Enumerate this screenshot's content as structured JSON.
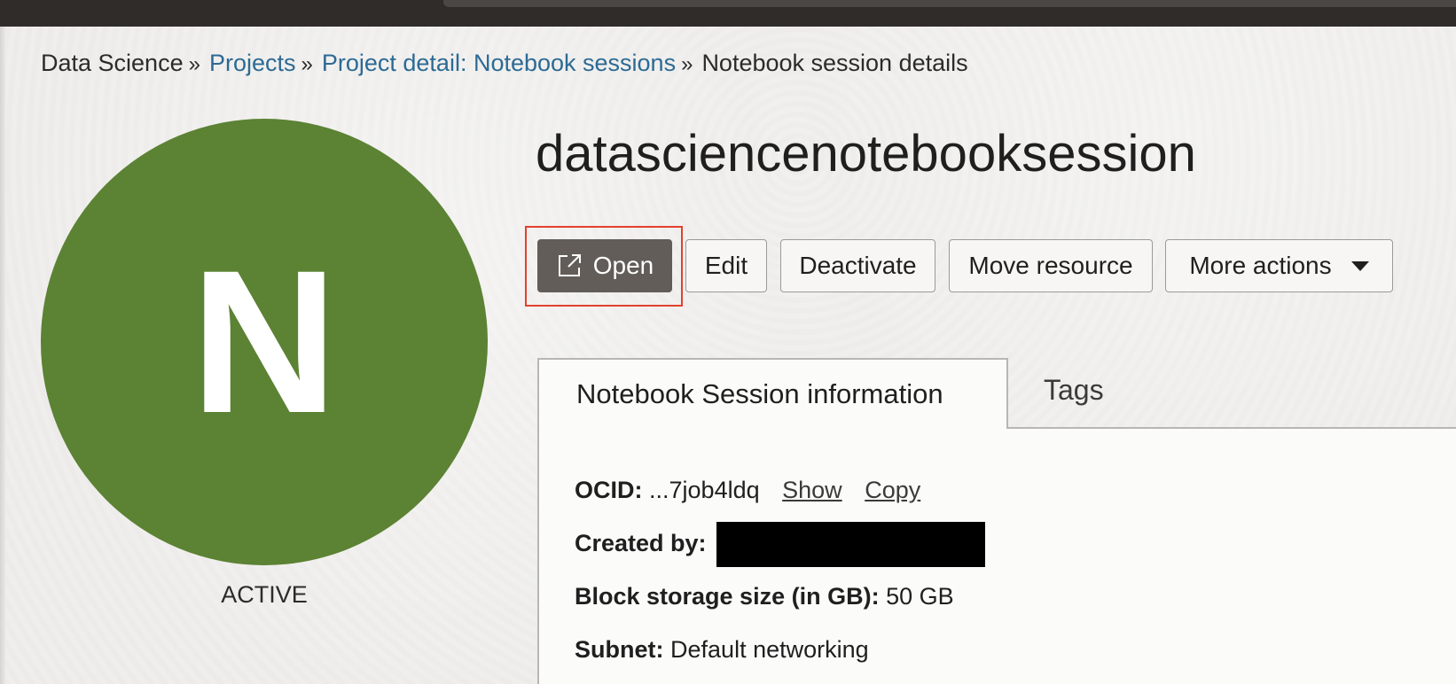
{
  "breadcrumb": {
    "root": "Data Science",
    "projects": "Projects",
    "project_detail": "Project detail: Notebook sessions",
    "current": "Notebook session details",
    "separator": "»"
  },
  "avatar": {
    "letter": "N",
    "color": "#5c8234",
    "status": "ACTIVE"
  },
  "title": "datasciencenotebooksession",
  "actions": {
    "open": "Open",
    "edit": "Edit",
    "deactivate": "Deactivate",
    "move_resource": "Move resource",
    "more_actions": "More actions"
  },
  "tabs": [
    {
      "label": "Notebook Session information",
      "active": true
    },
    {
      "label": "Tags",
      "active": false
    }
  ],
  "info": {
    "ocid_label": "OCID:",
    "ocid_value": "...7job4ldq",
    "show_link": "Show",
    "copy_link": "Copy",
    "created_by_label": "Created by:",
    "storage_label": "Block storage size (in GB):",
    "storage_value": "50 GB",
    "subnet_label": "Subnet:",
    "subnet_value": "Default networking"
  },
  "colors": {
    "open_button_bg": "#625d58",
    "highlight_border": "#e2412e",
    "link": "#2c6a94"
  },
  "icons": {
    "open": "external-link-icon",
    "more": "caret-down-icon"
  }
}
